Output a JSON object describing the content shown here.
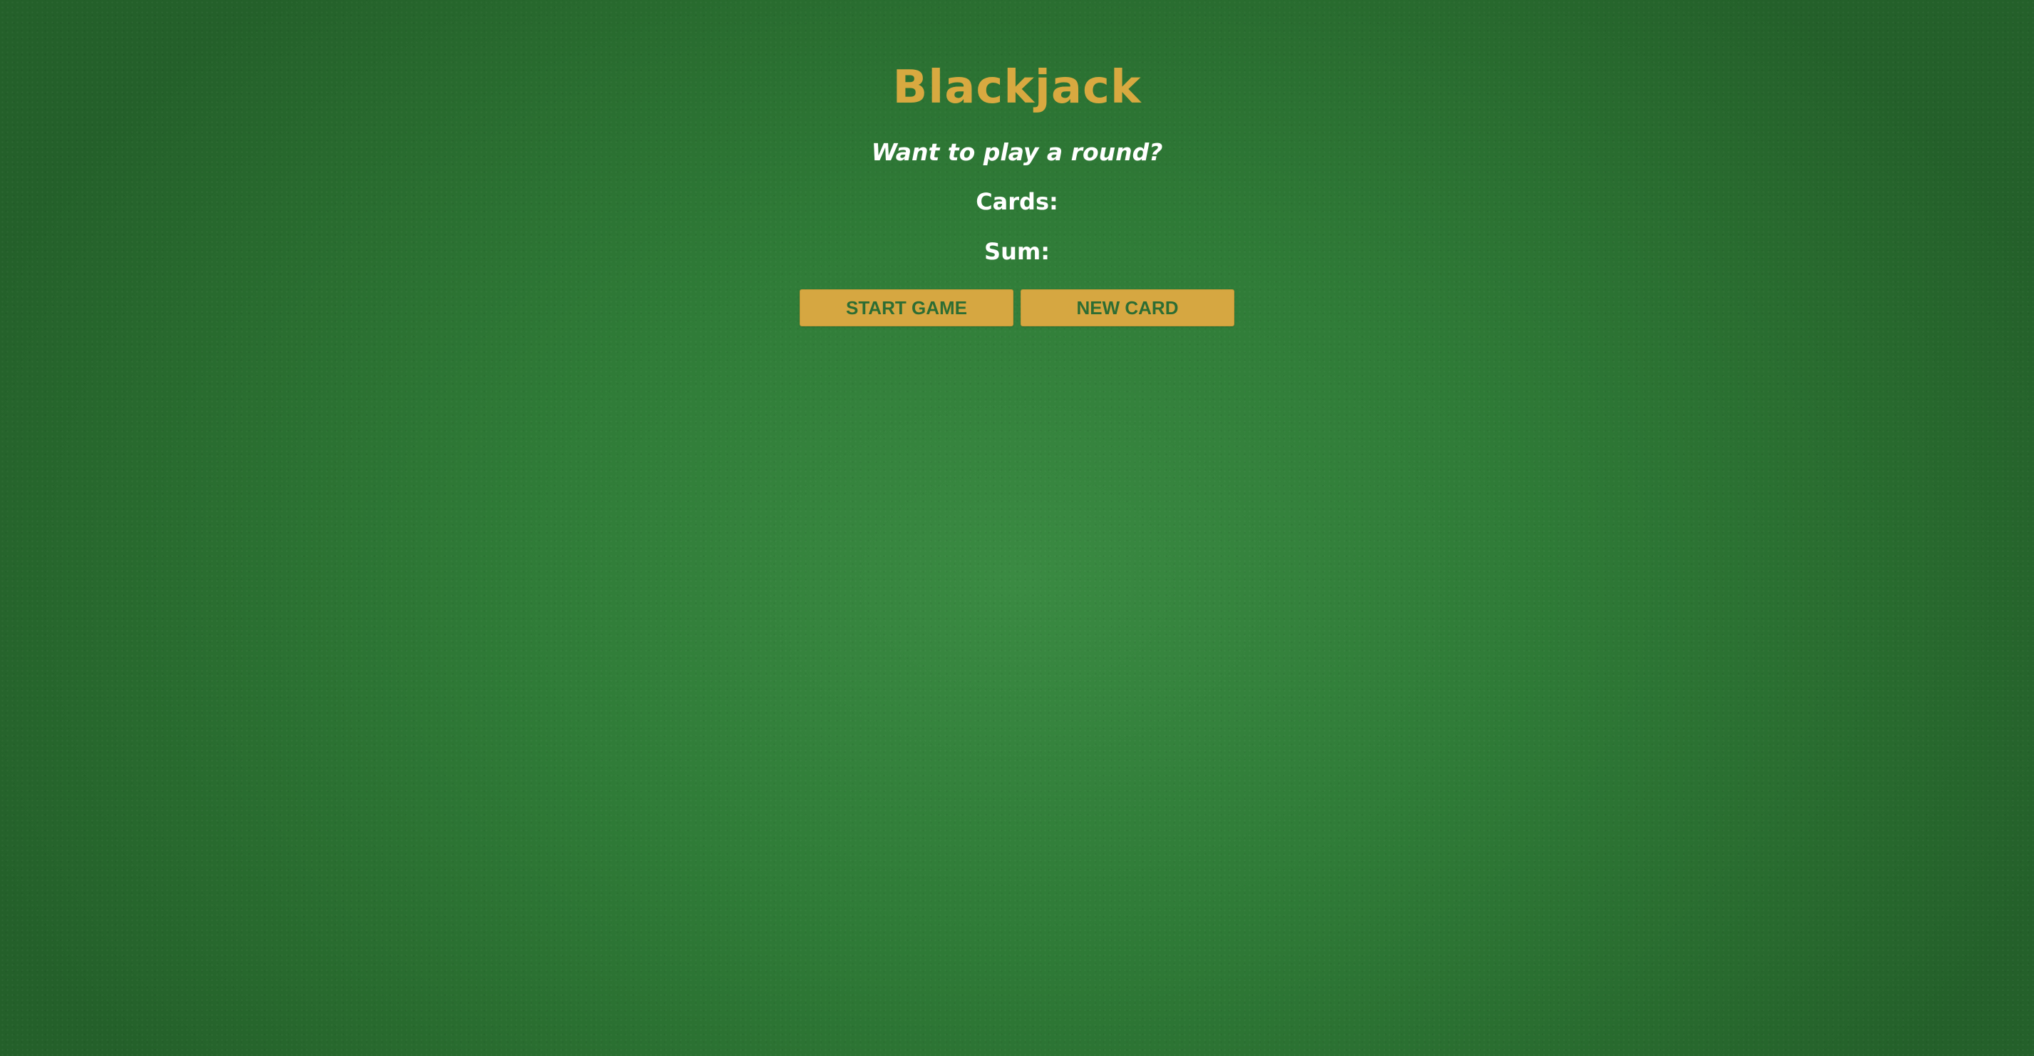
{
  "game": {
    "title": "Blackjack",
    "message": "Want to play a round?",
    "cards_label": "Cards:",
    "sum_label": "Sum:"
  },
  "controls": {
    "start_label": "START GAME",
    "new_card_label": "NEW CARD"
  },
  "colors": {
    "felt": "#2f7b37",
    "gold": "#d6a741",
    "button_text": "#2d6d33",
    "text": "#ffffff"
  }
}
